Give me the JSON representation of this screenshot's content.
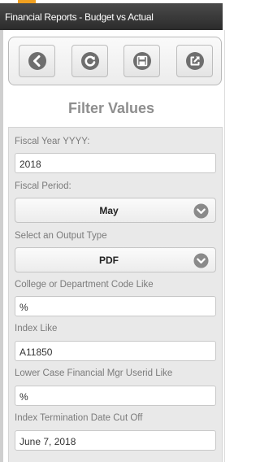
{
  "header": {
    "title": "Financial Reports - Budget vs Actual"
  },
  "toolbar": {
    "buttons": [
      {
        "icon": "back-icon"
      },
      {
        "icon": "refresh-icon"
      },
      {
        "icon": "save-icon"
      },
      {
        "icon": "share-icon"
      }
    ]
  },
  "filter": {
    "title": "Filter Values",
    "fiscal_year": {
      "label": "Fiscal Year YYYY:",
      "value": "2018"
    },
    "fiscal_period": {
      "label": "Fiscal Period:",
      "value": "May"
    },
    "output_type": {
      "label": "Select an Output Type",
      "value": "PDF"
    },
    "dept_code": {
      "label": "College or Department Code Like",
      "value": "%"
    },
    "index_like": {
      "label": "Index Like",
      "value": "A11850"
    },
    "mgr_userid": {
      "label": "Lower Case Financial Mgr Userid Like",
      "value": "%"
    },
    "term_date": {
      "label": "Index Termination Date Cut Off",
      "value": "June 7, 2018"
    }
  },
  "colors": {
    "header_bg": "#333333",
    "icon_gray": "#6e6e6e",
    "chevron_gray": "#8a8a8a",
    "panel_bg": "#e9e9e9",
    "accent_tab": "#f0a020"
  }
}
